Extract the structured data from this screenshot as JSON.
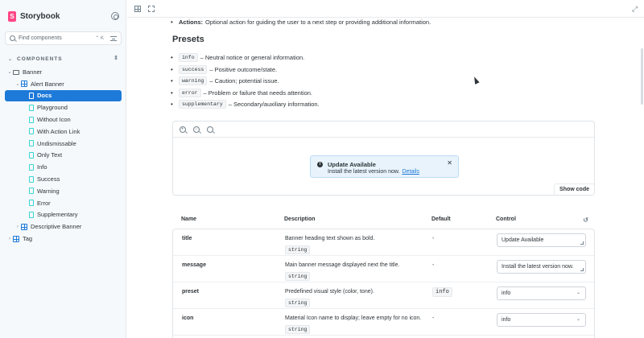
{
  "sidebar": {
    "brand": "Storybook",
    "search_placeholder": "Find components",
    "search_shortcut": "⌃ K",
    "section_title": "COMPONENTS",
    "tree": [
      {
        "label": "Banner",
        "level": 0,
        "kind": "folder",
        "expanded": true
      },
      {
        "label": "Alert Banner",
        "level": 1,
        "kind": "component",
        "expanded": true
      },
      {
        "label": "Docs",
        "level": 2,
        "kind": "doc",
        "active": true
      },
      {
        "label": "Playground",
        "level": 2,
        "kind": "story"
      },
      {
        "label": "Without Icon",
        "level": 2,
        "kind": "story"
      },
      {
        "label": "With Action Link",
        "level": 2,
        "kind": "story"
      },
      {
        "label": "Undismissable",
        "level": 2,
        "kind": "story"
      },
      {
        "label": "Only Text",
        "level": 2,
        "kind": "story"
      },
      {
        "label": "Info",
        "level": 2,
        "kind": "story"
      },
      {
        "label": "Success",
        "level": 2,
        "kind": "story"
      },
      {
        "label": "Warning",
        "level": 2,
        "kind": "story"
      },
      {
        "label": "Error",
        "level": 2,
        "kind": "story"
      },
      {
        "label": "Supplementary",
        "level": 2,
        "kind": "story"
      },
      {
        "label": "Descriptive Banner",
        "level": 1,
        "kind": "component",
        "expanded": false
      },
      {
        "label": "Tag",
        "level": 0,
        "kind": "component",
        "expanded": false
      }
    ]
  },
  "docs": {
    "actions_label": "Actions:",
    "actions_text": "Optional action for guiding the user to a next step or providing additional information.",
    "presets_heading": "Presets",
    "presets": [
      {
        "code": "info",
        "text": "– Neutral notice or general information."
      },
      {
        "code": "success",
        "text": "– Positive outcome/state."
      },
      {
        "code": "warning",
        "text": "– Caution; potential issue."
      },
      {
        "code": "error",
        "text": "– Problem or failure that needs attention."
      },
      {
        "code": "supplementary",
        "text": "– Secondary/auxiliary information."
      }
    ]
  },
  "preview": {
    "banner_title": "Update Available",
    "banner_message": "Install the latest version now.",
    "banner_link": "Details",
    "show_code": "Show code"
  },
  "args_table": {
    "headers": {
      "name": "Name",
      "description": "Description",
      "default": "Default",
      "control": "Control"
    },
    "rows": [
      {
        "name": "title",
        "description": "Banner heading text shown as bold.",
        "type": "string",
        "default": "-",
        "control": "Update Available",
        "control_kind": "text"
      },
      {
        "name": "message",
        "description": "Main banner message displayed next the title.",
        "type": "string",
        "default": "-",
        "control": "Install the latest version now.",
        "control_kind": "text"
      },
      {
        "name": "preset",
        "description": "Predefined visual style (color, tone).",
        "type": "string",
        "default": "info",
        "control": "info",
        "control_kind": "select"
      },
      {
        "name": "icon",
        "description": "Material Icon name to display; leave empty for no icon.",
        "type": "string",
        "default": "-",
        "control": "info",
        "control_kind": "select"
      }
    ]
  },
  "colors": {
    "accent": "#1e7ad8",
    "brand": "#ff4785",
    "banner_bg": "#e8f3fc"
  }
}
